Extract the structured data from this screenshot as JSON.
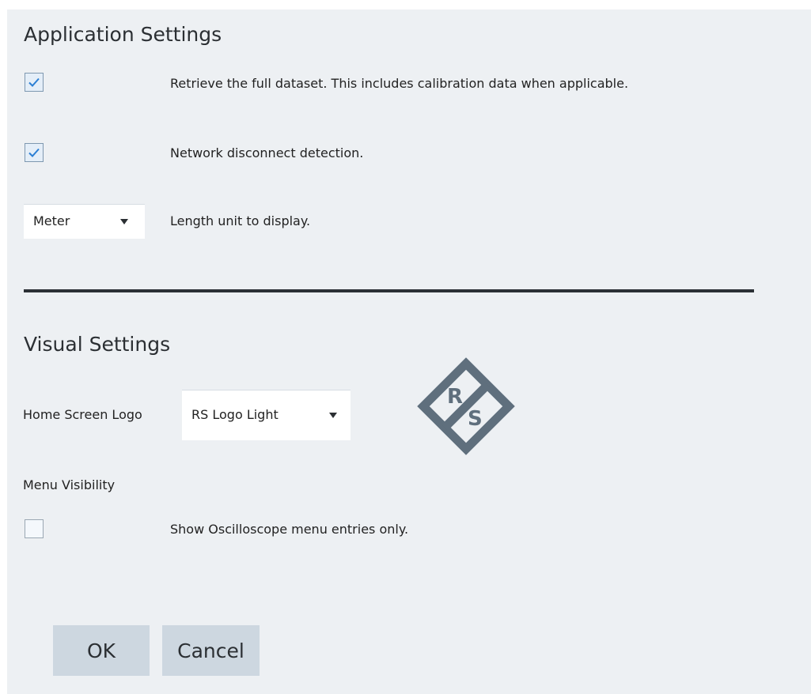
{
  "application_settings": {
    "title": "Application Settings",
    "full_dataset": {
      "checked": true,
      "label": "Retrieve the full dataset. This includes calibration data when applicable."
    },
    "network_disconnect": {
      "checked": true,
      "label": "Network disconnect detection."
    },
    "length_unit": {
      "selected": "Meter",
      "label": "Length unit to display."
    }
  },
  "visual_settings": {
    "title": "Visual Settings",
    "home_screen_logo": {
      "label": "Home Screen Logo",
      "selected": "RS Logo Light"
    },
    "logo_preview": {
      "icon": "rs-logo-icon",
      "color": "#5f6f7d"
    },
    "menu_visibility": {
      "label": "Menu Visibility",
      "oscilloscope_only": {
        "checked": false,
        "label": "Show Oscilloscope menu entries only."
      }
    }
  },
  "buttons": {
    "ok": "OK",
    "cancel": "Cancel"
  },
  "colors": {
    "dialog_bg": "#edf0f3",
    "button_bg": "#cdd7e0",
    "check_blue": "#2b7fd4",
    "divider": "#2b3035"
  }
}
